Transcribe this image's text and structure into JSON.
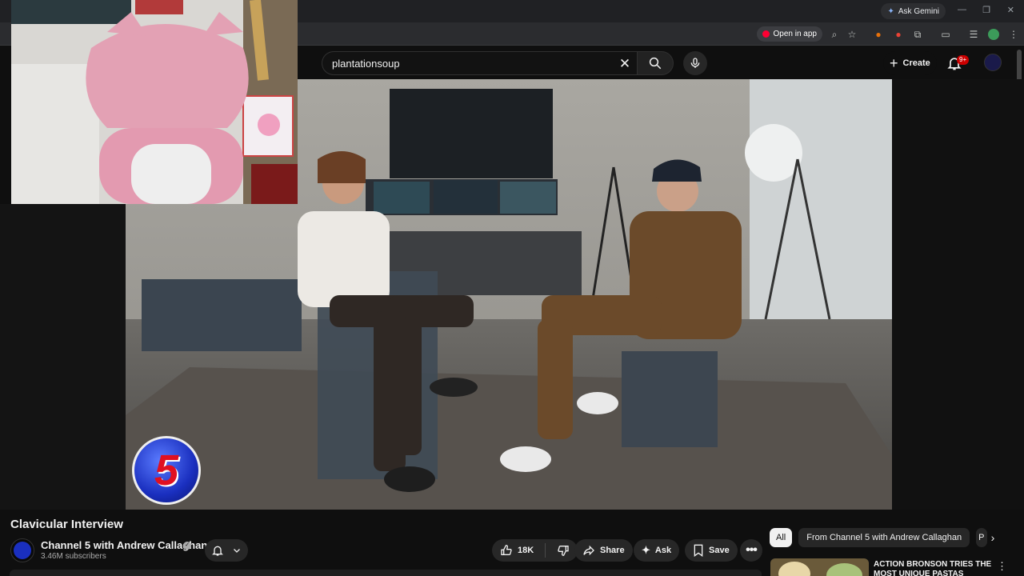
{
  "browser": {
    "gemini_label": "Ask Gemini",
    "open_in_app_label": "Open in app"
  },
  "header": {
    "search_value": "plantationsoup",
    "create_label": "Create",
    "notification_badge": "9+"
  },
  "video": {
    "title": "Clavicular Interview",
    "channel_name": "Channel 5 with Andrew Callaghan",
    "subscribers": "3.46M subscribers",
    "logo_numeral": "5"
  },
  "actions": {
    "like_count": "18K",
    "share_label": "Share",
    "ask_label": "Ask",
    "save_label": "Save"
  },
  "chips": [
    "All",
    "From Channel 5 with Andrew Callaghan",
    "P"
  ],
  "recommendation": {
    "title": "ACTION BRONSON TRIES THE MOST UNIQUE PASTAS"
  },
  "icons": {
    "search": "search-icon",
    "mic": "mic-icon",
    "bell": "bell-icon",
    "like": "thumbs-up-icon",
    "dislike": "thumbs-down-icon",
    "share": "share-icon",
    "ask": "sparkle-icon",
    "save": "bookmark-icon",
    "more": "more-icon"
  },
  "colors": {
    "background": "#0f0f0f",
    "accent": "#ff0033",
    "pill": "#272727"
  }
}
